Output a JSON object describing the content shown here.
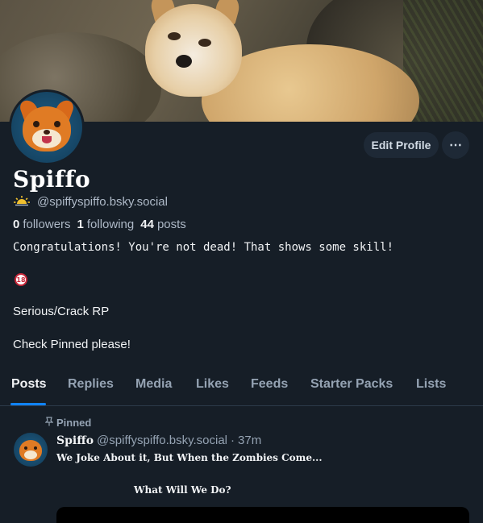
{
  "profile": {
    "display_name": "Spiffo",
    "handle_icon": "sun-icon",
    "handle": "@spiffyspiffo.bsky.social",
    "followers_count": "0",
    "followers_label": "followers",
    "following_count": "1",
    "following_label": "following",
    "posts_count": "44",
    "posts_label": "posts",
    "bio": {
      "line1": "Congratulations! You're not dead! That shows some skill!",
      "badge": "18",
      "line2": "Serious/Crack RP",
      "line3": "Check Pinned please!"
    }
  },
  "actions": {
    "edit_profile": "Edit Profile",
    "more": "⋯"
  },
  "tabs": [
    {
      "label": "Posts",
      "active": true
    },
    {
      "label": "Replies"
    },
    {
      "label": "Media"
    },
    {
      "label": "Likes"
    },
    {
      "label": "Feeds"
    },
    {
      "label": "Starter Packs"
    },
    {
      "label": "Lists"
    }
  ],
  "pinned_post": {
    "pinned_label": "Pinned",
    "author_name": "Spiffo",
    "author_handle": "@spiffyspiffo.bsky.social",
    "separator": "·",
    "time": "37m",
    "text_line1": "We Joke About it, But When the Zombies Come...",
    "text_line2": "What Will We Do?"
  },
  "colors": {
    "background": "#161e27",
    "accent": "#1083fe",
    "button": "#1e2936"
  }
}
